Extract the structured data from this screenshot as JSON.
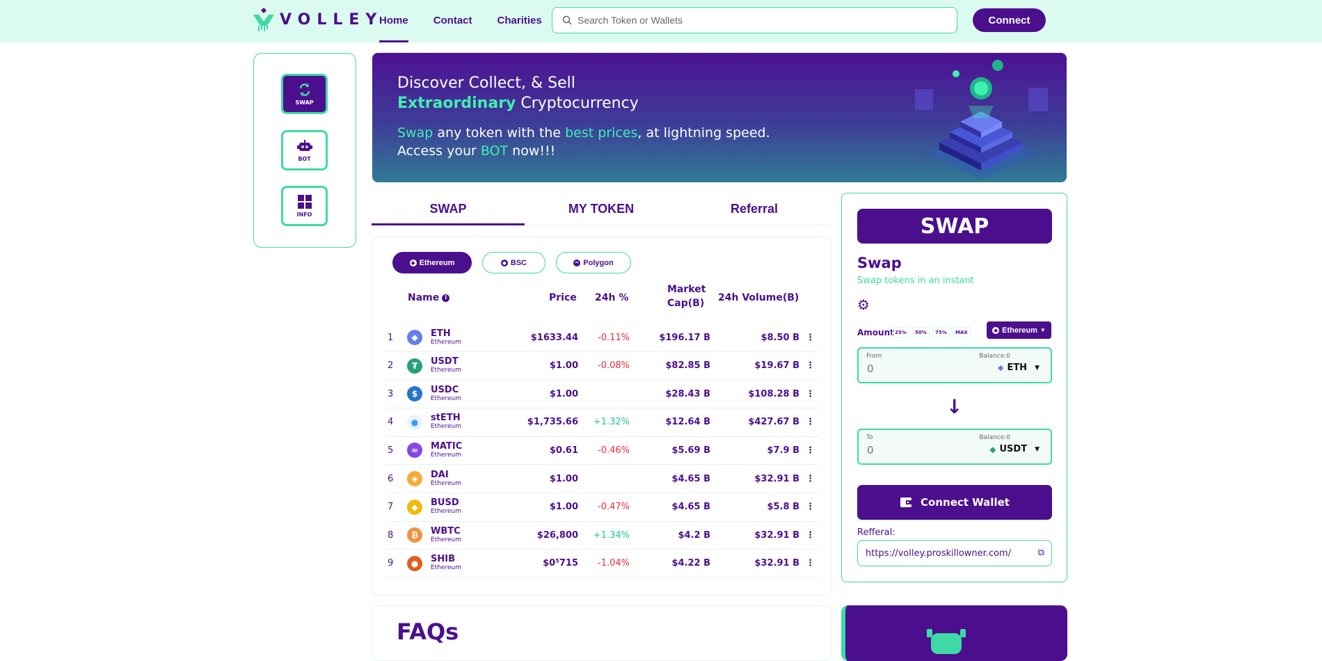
{
  "header": {
    "logo_text": "VOLLEY",
    "nav": [
      {
        "label": "Home",
        "active": true
      },
      {
        "label": "Contact",
        "active": false
      },
      {
        "label": "Charities",
        "active": false
      }
    ],
    "search_placeholder": "Search Token or Wallets",
    "connect_label": "Connect"
  },
  "rail": {
    "items": [
      {
        "label": "SWAP",
        "icon": "refresh-icon",
        "active": true
      },
      {
        "label": "BOT",
        "icon": "robot-icon",
        "active": false
      },
      {
        "label": "INFO",
        "icon": "grid-icon",
        "active": false
      }
    ]
  },
  "banner": {
    "line1": "Discover Collect, & Sell",
    "line2_hl": "Extraordinary",
    "line2_rest": " Cryptocurrency",
    "line3_a": "Swap",
    "line3_b": " any token with the ",
    "line3_c": "best prices",
    "line3_d": ", at lightning speed.",
    "line4_a": "Access your ",
    "line4_b": "BOT",
    "line4_c": " now!!!"
  },
  "tabs": [
    {
      "label": "SWAP",
      "active": true
    },
    {
      "label": "MY TOKEN",
      "active": false
    },
    {
      "label": "Referral",
      "active": false
    }
  ],
  "chips": [
    {
      "label": "Ethereum",
      "active": true
    },
    {
      "label": "BSC",
      "active": false
    },
    {
      "label": "Polygon",
      "active": false
    }
  ],
  "table": {
    "headers": {
      "name": "Name",
      "price": "Price",
      "change": "24h %",
      "cap_l1": "Market",
      "cap_l2": "Cap(B)",
      "volume": "24h Volume(B)"
    },
    "rows": [
      {
        "idx": "1",
        "symbol": "ETH",
        "network": "Ethereum",
        "price": "$1633.44",
        "change": "-0.11%",
        "dir": "neg",
        "cap": "$196.17 B",
        "vol": "$8.50 B",
        "icon": "eth-icon",
        "color": "#627eea"
      },
      {
        "idx": "2",
        "symbol": "USDT",
        "network": "Ethereum",
        "price": "$1.00",
        "change": "-0.08%",
        "dir": "neg",
        "cap": "$82.85 B",
        "vol": "$19.67 B",
        "icon": "usdt-icon",
        "color": "#26a17b"
      },
      {
        "idx": "3",
        "symbol": "USDC",
        "network": "Ethereum",
        "price": "$1.00",
        "change": "",
        "dir": "",
        "cap": "$28.43 B",
        "vol": "$108.28 B",
        "icon": "usdc-icon",
        "color": "#2775ca"
      },
      {
        "idx": "4",
        "symbol": "stETH",
        "network": "Ethereum",
        "price": "$1,735.66",
        "change": "+1.32%",
        "dir": "pos",
        "cap": "$12.64 B",
        "vol": "$427.67 B",
        "icon": "steth-icon",
        "color": "#e8f3ff"
      },
      {
        "idx": "5",
        "symbol": "MATIC",
        "network": "Ethereum",
        "price": "$0.61",
        "change": "-0.46%",
        "dir": "neg",
        "cap": "$5.69 B",
        "vol": "$7.9 B",
        "icon": "matic-icon",
        "color": "#8247e5"
      },
      {
        "idx": "6",
        "symbol": "DAI",
        "network": "Ethereum",
        "price": "$1.00",
        "change": "",
        "dir": "",
        "cap": "$4.65 B",
        "vol": "$32.91 B",
        "icon": "dai-icon",
        "color": "#f5ac37"
      },
      {
        "idx": "7",
        "symbol": "BUSD",
        "network": "Ethereum",
        "price": "$1.00",
        "change": "-0.47%",
        "dir": "neg",
        "cap": "$4.65 B",
        "vol": "$5.8 B",
        "icon": "busd-icon",
        "color": "#f0b90b"
      },
      {
        "idx": "8",
        "symbol": "WBTC",
        "network": "Ethereum",
        "price": "$26,800",
        "change": "+1.34%",
        "dir": "pos",
        "cap": "$4.2 B",
        "vol": "$32.91 B",
        "icon": "wbtc-icon",
        "color": "#f09242"
      },
      {
        "idx": "9",
        "symbol": "SHIB",
        "network": "Ethereum",
        "price": "$0⁵715",
        "change": "-1.04%",
        "dir": "neg",
        "cap": "$4.22 B",
        "vol": "$32.91 B",
        "icon": "shib-icon",
        "color": "#e35e1b"
      }
    ]
  },
  "swap": {
    "header": "SWAP",
    "title": "Swap",
    "subtitle": "Swap tokens in an instant",
    "amount_label": "Amount",
    "pcts": [
      "25%",
      "50%",
      "75%",
      "MAX"
    ],
    "network": "Ethereum",
    "from": {
      "label": "From",
      "balance": "Balance:0",
      "value": "0",
      "token": "ETH"
    },
    "to": {
      "label": "To",
      "balance": "Balance:0",
      "value": "0",
      "token": "USDT"
    },
    "connect_wallet": "Connect Wallet",
    "referral_label": "Refferal:",
    "referral_url": "https://volley.proskillowner.com/"
  },
  "faq": {
    "title": "FAQs"
  },
  "colors": {
    "primary": "#4b0f8e",
    "accent": "#3fd9a5",
    "header_bg": "#dcfbf0",
    "negative": "#ef2b3b",
    "positive": "#22c98f"
  }
}
